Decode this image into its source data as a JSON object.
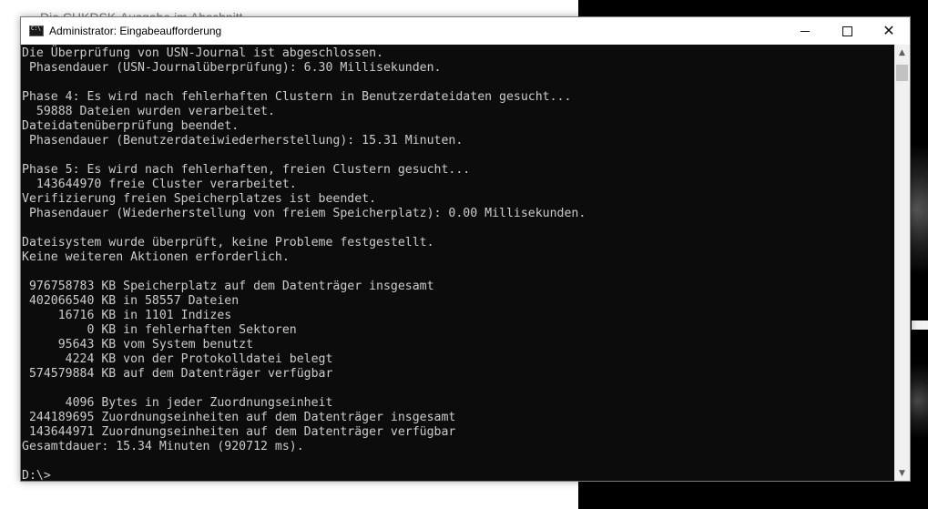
{
  "background": {
    "behind_text": "Die CHKDSK-Ausgabe im Abschnitt"
  },
  "window": {
    "title": "Administrator: Eingabeaufforderung",
    "icon": "cmd-icon",
    "controls": {
      "minimize_icon": "minimize-icon",
      "maximize_icon": "maximize-icon",
      "close_icon": "close-icon"
    }
  },
  "console": {
    "lines": [
      "Die Überprüfung von USN-Journal ist abgeschlossen.",
      " Phasendauer (USN-Journalüberprüfung): 6.30 Millisekunden.",
      "",
      "Phase 4: Es wird nach fehlerhaften Clustern in Benutzerdateidaten gesucht...",
      "  59888 Dateien wurden verarbeitet.",
      "Dateidatenüberprüfung beendet.",
      " Phasendauer (Benutzerdateiwiederherstellung): 15.31 Minuten.",
      "",
      "Phase 5: Es wird nach fehlerhaften, freien Clustern gesucht...",
      "  143644970 freie Cluster verarbeitet.",
      "Verifizierung freien Speicherplatzes ist beendet.",
      " Phasendauer (Wiederherstellung von freiem Speicherplatz): 0.00 Millisekunden.",
      "",
      "Dateisystem wurde überprüft, keine Probleme festgestellt.",
      "Keine weiteren Aktionen erforderlich.",
      "",
      " 976758783 KB Speicherplatz auf dem Datenträger insgesamt",
      " 402066540 KB in 58557 Dateien",
      "     16716 KB in 1101 Indizes",
      "         0 KB in fehlerhaften Sektoren",
      "     95643 KB vom System benutzt",
      "      4224 KB von der Protokolldatei belegt",
      " 574579884 KB auf dem Datenträger verfügbar",
      "",
      "      4096 Bytes in jeder Zuordnungseinheit",
      " 244189695 Zuordnungseinheiten auf dem Datenträger insgesamt",
      " 143644971 Zuordnungseinheiten auf dem Datenträger verfügbar",
      "Gesamtdauer: 15.34 Minuten (920712 ms).",
      "",
      "D:\\>"
    ]
  },
  "scrollbar": {
    "up_icon": "scroll-up-arrow-icon",
    "down_icon": "scroll-down-arrow-icon"
  },
  "colors": {
    "console_bg": "#0c0c0c",
    "console_fg": "#cccccc",
    "titlebar_bg": "#ffffff"
  }
}
